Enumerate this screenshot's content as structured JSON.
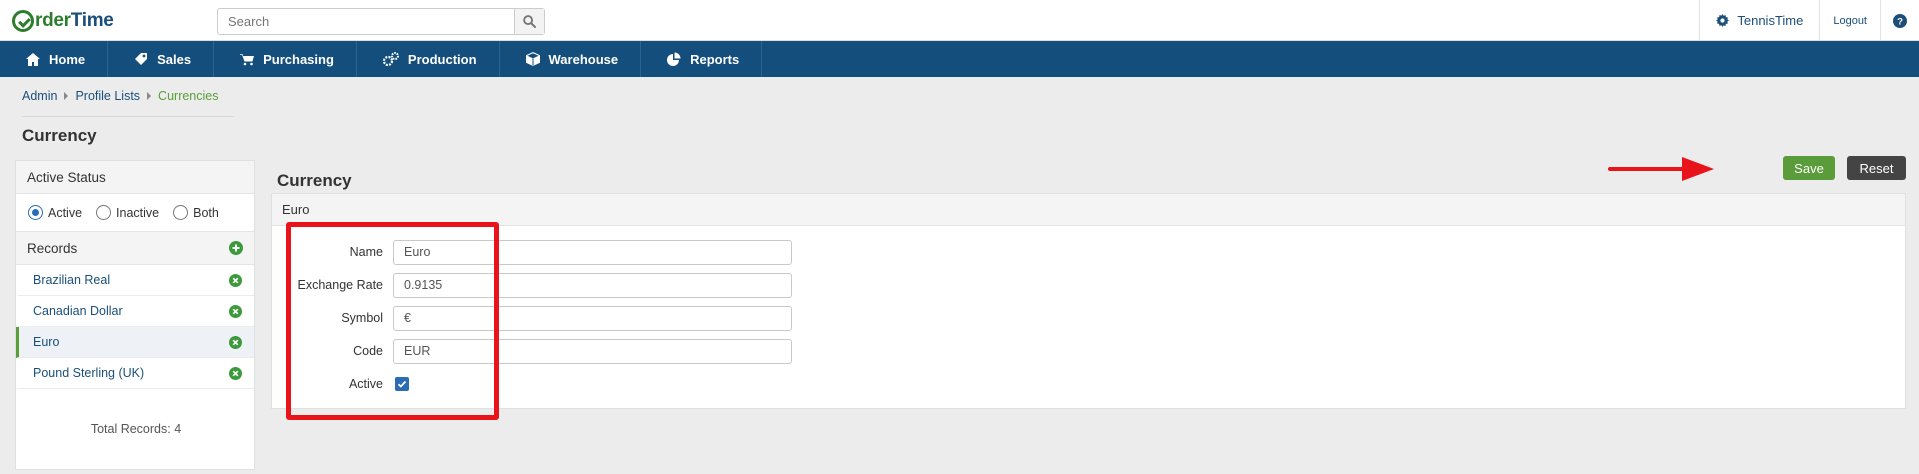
{
  "app": {
    "logo_part1": "rder",
    "logo_part2": "Time",
    "logo_icon": "ordertime-logo-icon"
  },
  "search": {
    "placeholder": "Search",
    "icon": "search-icon"
  },
  "topright": {
    "user": "TennisTime",
    "logout": "Logout",
    "user_icon": "gear-icon",
    "help_icon": "help-icon"
  },
  "nav": {
    "items": [
      {
        "label": "Home",
        "icon": "home-icon"
      },
      {
        "label": "Sales",
        "icon": "tag-icon"
      },
      {
        "label": "Purchasing",
        "icon": "cart-icon"
      },
      {
        "label": "Production",
        "icon": "gears-icon"
      },
      {
        "label": "Warehouse",
        "icon": "box-icon"
      },
      {
        "label": "Reports",
        "icon": "pie-chart-icon"
      }
    ]
  },
  "breadcrumb": {
    "items": [
      "Admin",
      "Profile Lists"
    ],
    "current": "Currencies"
  },
  "page_title": "Currency",
  "sidebar": {
    "status_heading": "Active Status",
    "status_options": [
      "Active",
      "Inactive",
      "Both"
    ],
    "status_selected": "Active",
    "records_heading": "Records",
    "records": [
      "Brazilian Real",
      "Canadian Dollar",
      "Euro",
      "Pound Sterling (UK)"
    ],
    "selected_record": "Euro",
    "total": "Total Records: 4"
  },
  "main": {
    "title": "Currency",
    "panel_heading": "Euro",
    "save": "Save",
    "reset": "Reset",
    "fields": {
      "name": {
        "label": "Name",
        "value": "Euro"
      },
      "rate": {
        "label": "Exchange Rate",
        "value": "0.9135"
      },
      "symbol": {
        "label": "Symbol",
        "value": "€"
      },
      "code": {
        "label": "Code",
        "value": "EUR"
      },
      "active": {
        "label": "Active",
        "checked": true
      }
    }
  },
  "colors": {
    "nav": "#134e7d",
    "accent_green": "#5a9b3a",
    "link": "#1b4f7a",
    "annotation": "#e8141a"
  }
}
